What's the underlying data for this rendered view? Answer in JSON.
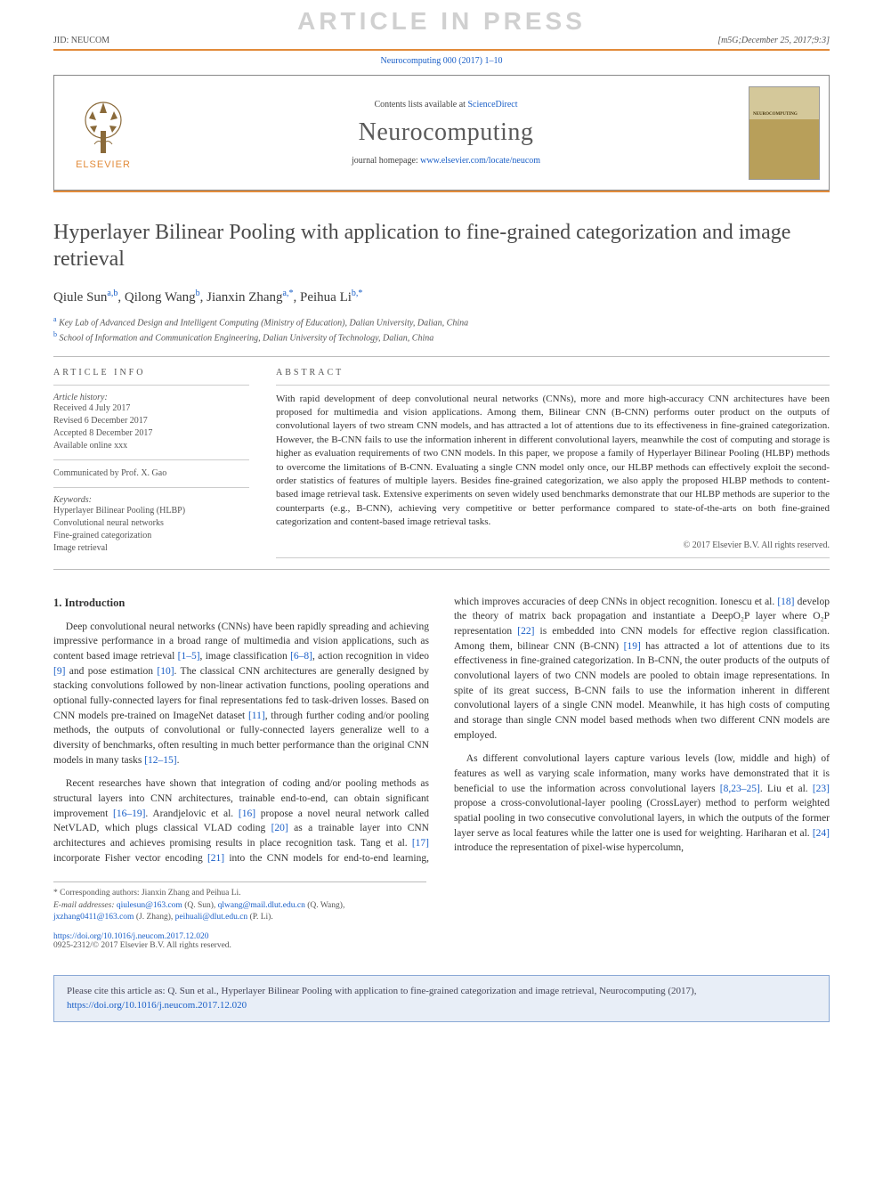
{
  "watermark": "ARTICLE IN PRESS",
  "topbar": {
    "jid": "JID: NEUCOM",
    "meta": "[m5G;December 25, 2017;9:3]"
  },
  "journal_ref": {
    "text": "Neurocomputing 000 (2017) 1–10",
    "url_label": ""
  },
  "masthead": {
    "contentslists_prefix": "Contents lists available at ",
    "contentslists_link": "ScienceDirect",
    "journal_name": "Neurocomputing",
    "homepage_prefix": "journal homepage: ",
    "homepage_link": "www.elsevier.com/locate/neucom",
    "publisher": "ELSEVIER",
    "cover_label": "NEUROCOMPUTING"
  },
  "title": "Hyperlayer Bilinear Pooling with application to fine-grained categorization and image retrieval",
  "authors": [
    {
      "name": "Qiule Sun",
      "aff": "a,b"
    },
    {
      "name": "Qilong Wang",
      "aff": "b"
    },
    {
      "name": "Jianxin Zhang",
      "aff": "a,",
      "star": "*"
    },
    {
      "name": "Peihua Li",
      "aff": "b,",
      "star": "*"
    }
  ],
  "affiliations": [
    {
      "key": "a",
      "text": "Key Lab of Advanced Design and Intelligent Computing (Ministry of Education), Dalian University, Dalian, China"
    },
    {
      "key": "b",
      "text": "School of Information and Communication Engineering, Dalian University of Technology, Dalian, China"
    }
  ],
  "article_info": {
    "header": "article info",
    "history_label": "Article history:",
    "history": [
      "Received 4 July 2017",
      "Revised 6 December 2017",
      "Accepted 8 December 2017",
      "Available online xxx"
    ],
    "communicated": "Communicated by Prof. X. Gao",
    "keywords_label": "Keywords:",
    "keywords": [
      "Hyperlayer Bilinear Pooling (HLBP)",
      "Convolutional neural networks",
      "Fine-grained categorization",
      "Image retrieval"
    ]
  },
  "abstract": {
    "header": "abstract",
    "text": "With rapid development of deep convolutional neural networks (CNNs), more and more high-accuracy CNN architectures have been proposed for multimedia and vision applications. Among them, Bilinear CNN (B-CNN) performs outer product on the outputs of convolutional layers of two stream CNN models, and has attracted a lot of attentions due to its effectiveness in fine-grained categorization. However, the B-CNN fails to use the information inherent in different convolutional layers, meanwhile the cost of computing and storage is higher as evaluation requirements of two CNN models. In this paper, we propose a family of Hyperlayer Bilinear Pooling (HLBP) methods to overcome the limitations of B-CNN. Evaluating a single CNN model only once, our HLBP methods can effectively exploit the second-order statistics of features of multiple layers. Besides fine-grained categorization, we also apply the proposed HLBP methods to content-based image retrieval task. Extensive experiments on seven widely used benchmarks demonstrate that our HLBP methods are superior to the counterparts (e.g., B-CNN), achieving very competitive or better performance compared to state-of-the-arts on both fine-grained categorization and content-based image retrieval tasks.",
    "copyright": "© 2017 Elsevier B.V. All rights reserved."
  },
  "body": {
    "section_heading": "1. Introduction",
    "p1_a": "Deep convolutional neural networks (CNNs) have been rapidly spreading and achieving impressive performance in a broad range of multimedia and vision applications, such as content based image retrieval ",
    "c1": "[1–5]",
    "p1_b": ", image classification ",
    "c2": "[6–8]",
    "p1_c": ", action recognition in video ",
    "c3": "[9]",
    "p1_d": " and pose estimation ",
    "c4": "[10]",
    "p1_e": ". The classical CNN architectures are generally designed by stacking convolutions followed by non-linear activation functions, pooling operations and optional fully-connected layers for final representations fed to task-driven losses. Based on CNN models pre-trained on ImageNet dataset ",
    "c5": "[11]",
    "p1_f": ", through further coding and/or pooling methods, the outputs of convolutional or fully-connected layers generalize well to a diversity of benchmarks, often resulting in much better performance than the original CNN models in many tasks ",
    "c6": "[12–15]",
    "p1_g": ".",
    "p2_a": "Recent researches have shown that integration of coding and/or pooling methods as structural layers into CNN architectures, trainable end-to-end, can obtain significant improvement ",
    "c7": "[16–19]",
    "p2_b": ". Arandjelovic et al. ",
    "c8": "[16]",
    "p2_c": " propose a novel neural network called NetVLAD, which plugs classical VLAD coding ",
    "c9": "[20]",
    "p2_d": " as a trainable layer into CNN architectures and achieves promising results in place recognition task. Tang et al. ",
    "c10": "[17]",
    "p2_e": " incorporate Fisher vector encoding ",
    "c11": "[21]",
    "p2_f": " into the CNN models for end-to-end learning, which improves accuracies of deep CNNs in object recognition. Ionescu et al. ",
    "c12": "[18]",
    "p2_g": " develop the theory of matrix back propagation and instantiate a DeepO₂P layer where O₂P representation ",
    "c13": "[22]",
    "p2_h": " is embedded into CNN models for effective region classification. Among them, bilinear CNN (B-CNN) ",
    "c14": "[19]",
    "p2_i": " has attracted a lot of attentions due to its effectiveness in fine-grained categorization. In B-CNN, the outer products of the outputs of convolutional layers of two CNN models are pooled to obtain image representations. In spite of its great success, B-CNN fails to use the information inherent in different convolutional layers of a single CNN model. Meanwhile, it has high costs of computing and storage than single CNN model based methods when two different CNN models are employed.",
    "p3_a": "As different convolutional layers capture various levels (low, middle and high) of features as well as varying scale information, many works have demonstrated that it is beneficial to use the information across convolutional layers ",
    "c15": "[8,23–25]",
    "p3_b": ". Liu et al. ",
    "c16": "[23]",
    "p3_c": " propose a cross-convolutional-layer pooling (CrossLayer) method to perform weighted spatial pooling in two consecutive convolutional layers, in which the outputs of the former layer serve as local features while the latter one is used for weighting. Hariharan et al. ",
    "c17": "[24]",
    "p3_d": " introduce the representation of pixel-wise hypercolumn,"
  },
  "footnotes": {
    "corr_label": "* Corresponding authors: Jianxin Zhang and Peihua Li.",
    "email_label": "E-mail addresses:",
    "emails": [
      {
        "addr": "qiulesun@163.com",
        "who": "(Q. Sun)"
      },
      {
        "addr": "qlwang@mail.dlut.edu.cn",
        "who": "(Q. Wang)"
      },
      {
        "addr": "jxzhang0411@163.com",
        "who": "(J. Zhang)"
      },
      {
        "addr": "peihuali@dlut.edu.cn",
        "who": "(P. Li)."
      }
    ]
  },
  "doi": {
    "url": "https://doi.org/10.1016/j.neucom.2017.12.020",
    "issn_line": "0925-2312/© 2017 Elsevier B.V. All rights reserved."
  },
  "citebox": {
    "prefix": "Please cite this article as: Q. Sun et al., Hyperlayer Bilinear Pooling with application to fine-grained categorization and image retrieval, Neurocomputing (2017), ",
    "link": "https://doi.org/10.1016/j.neucom.2017.12.020"
  }
}
